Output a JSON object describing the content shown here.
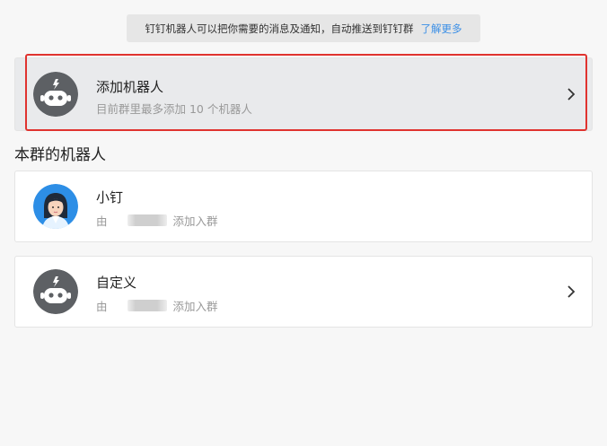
{
  "notice": {
    "text": "钉钉机器人可以把你需要的消息及通知，自动推送到钉钉群",
    "link": "了解更多"
  },
  "add_robot": {
    "title": "添加机器人",
    "subtitle": "目前群里最多添加 10 个机器人",
    "icon": "robot-icon"
  },
  "section": {
    "title": "本群的机器人"
  },
  "robots": [
    {
      "name": "小钉",
      "by_prefix": "由",
      "by_suffix": "添加入群",
      "icon": "assistant-avatar"
    },
    {
      "name": "自定义",
      "by_prefix": "由",
      "by_suffix": "添加入群",
      "icon": "robot-icon"
    }
  ],
  "colors": {
    "accent_link": "#3b8fe6",
    "highlight": "#e0332f",
    "robot_avatar_bg": "#5d6064"
  }
}
